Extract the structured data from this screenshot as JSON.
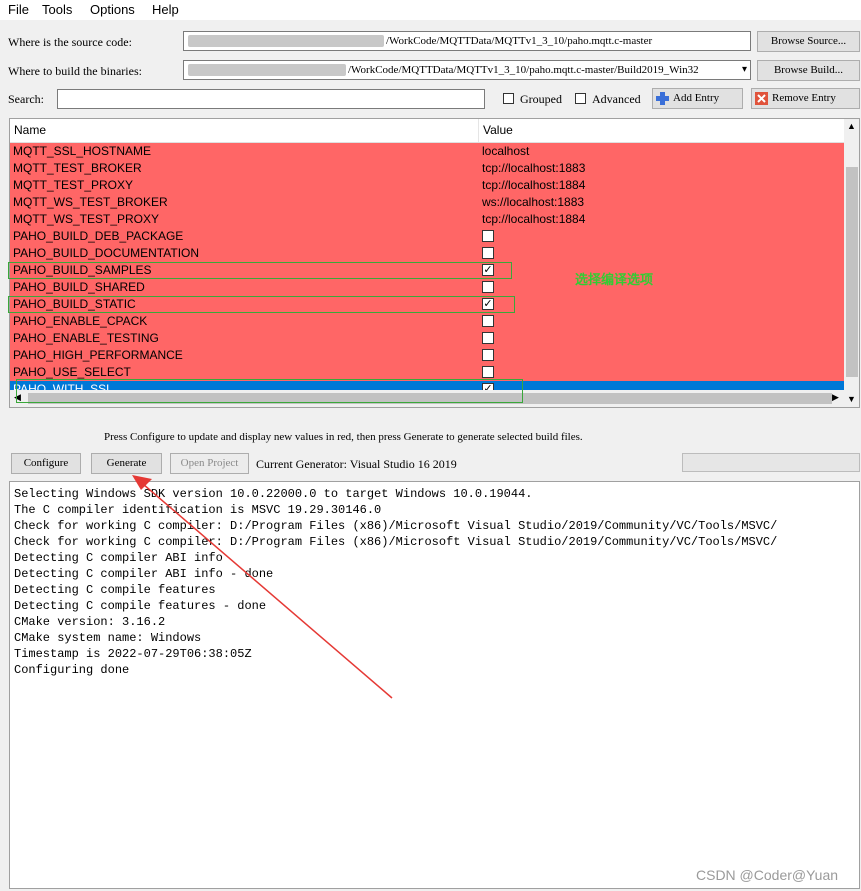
{
  "menu": [
    "File",
    "Tools",
    "Options",
    "Help"
  ],
  "source": {
    "label": "Where is the source code:",
    "path": "/WorkCode/MQTTData/MQTTv1_3_10/paho.mqtt.c-master",
    "browse": "Browse Source..."
  },
  "build": {
    "label": "Where to build the binaries:",
    "path": "/WorkCode/MQTTData/MQTTv1_3_10/paho.mqtt.c-master/Build2019_Win32",
    "browse": "Browse Build..."
  },
  "search": {
    "label": "Search:",
    "value": "",
    "grouped": "Grouped",
    "advanced": "Advanced",
    "add_entry": "Add Entry",
    "remove_entry": "Remove Entry"
  },
  "table": {
    "col_name": "Name",
    "col_value": "Value",
    "rows": [
      {
        "name": "MQTT_SSL_HOSTNAME",
        "value": "localhost"
      },
      {
        "name": "MQTT_TEST_BROKER",
        "value": "tcp://localhost:1883"
      },
      {
        "name": "MQTT_TEST_PROXY",
        "value": "tcp://localhost:1884"
      },
      {
        "name": "MQTT_WS_TEST_BROKER",
        "value": "ws://localhost:1883"
      },
      {
        "name": "MQTT_WS_TEST_PROXY",
        "value": "tcp://localhost:1884"
      },
      {
        "name": "PAHO_BUILD_DEB_PACKAGE",
        "checked": false
      },
      {
        "name": "PAHO_BUILD_DOCUMENTATION",
        "checked": false
      },
      {
        "name": "PAHO_BUILD_SAMPLES",
        "checked": true
      },
      {
        "name": "PAHO_BUILD_SHARED",
        "checked": false
      },
      {
        "name": "PAHO_BUILD_STATIC",
        "checked": true
      },
      {
        "name": "PAHO_ENABLE_CPACK",
        "checked": false
      },
      {
        "name": "PAHO_ENABLE_TESTING",
        "checked": false
      },
      {
        "name": "PAHO_HIGH_PERFORMANCE",
        "checked": false
      },
      {
        "name": "PAHO_USE_SELECT",
        "checked": false
      },
      {
        "name": "PAHO_WITH_SSL",
        "checked": true
      }
    ]
  },
  "annotation": "选择编译选项",
  "hint": "Press Configure to update and display new values in red, then press Generate to generate selected build files.",
  "buttons": {
    "configure": "Configure",
    "generate": "Generate",
    "open_project": "Open Project"
  },
  "generator": "Current Generator: Visual Studio 16 2019",
  "output": [
    "Selecting Windows SDK version 10.0.22000.0 to target Windows 10.0.19044.",
    "The C compiler identification is MSVC 19.29.30146.0",
    "Check for working C compiler: D:/Program Files (x86)/Microsoft Visual Studio/2019/Community/VC/Tools/MSVC/",
    "Check for working C compiler: D:/Program Files (x86)/Microsoft Visual Studio/2019/Community/VC/Tools/MSVC/",
    "Detecting C compiler ABI info",
    "Detecting C compiler ABI info - done",
    "Detecting C compile features",
    "Detecting C compile features - done",
    "CMake version: 3.16.2",
    "CMake system name: Windows",
    "Timestamp is 2022-07-29T06:38:05Z",
    "Configuring done"
  ],
  "watermark": "CSDN @Coder@Yuan",
  "colors": {
    "changed_row": "#ff6666",
    "selected_row": "#0078d7",
    "annotation": "#33cc33",
    "arrow": "#e53935"
  }
}
